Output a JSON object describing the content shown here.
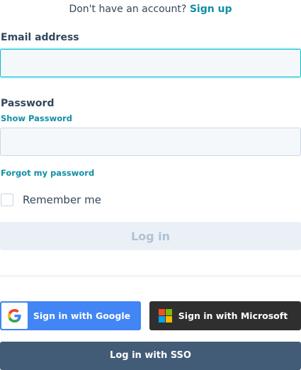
{
  "signup": {
    "prompt": "Don't have an account?",
    "link": "Sign up"
  },
  "email": {
    "label": "Email address",
    "value": "",
    "placeholder": ""
  },
  "password": {
    "label": "Password",
    "show_label": "Show Password",
    "value": "",
    "placeholder": ""
  },
  "forgot_label": "Forgot my password",
  "remember": {
    "label": "Remember me",
    "checked": false
  },
  "login_label": "Log in",
  "google": {
    "label": "Sign in with Google",
    "icon": "google-icon",
    "color": "#4285f4"
  },
  "microsoft": {
    "label": "Sign in with Microsoft",
    "icon": "microsoft-icon",
    "color": "#2f2f2f"
  },
  "sso_label": "Log in with SSO",
  "colors": {
    "accent": "#0f8fa5",
    "sso": "#425b76",
    "login_disabled_bg": "#eaf0f6",
    "focus_border": "#00bcd4"
  }
}
